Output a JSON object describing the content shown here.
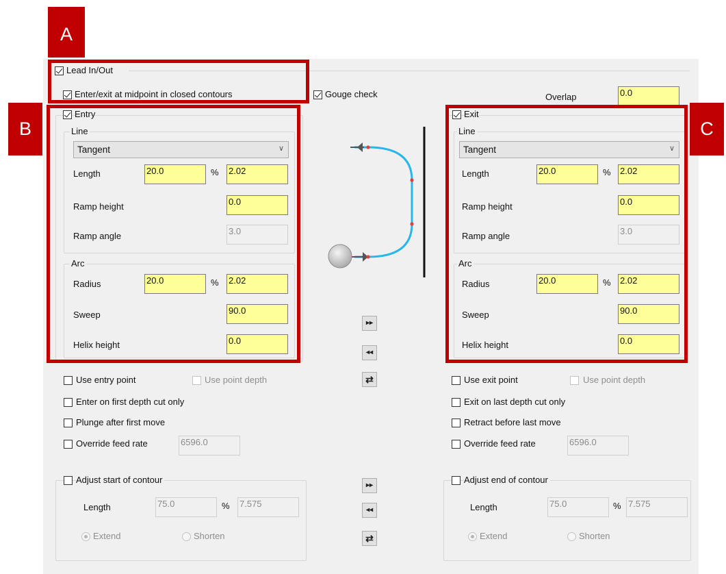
{
  "annotations": {
    "a": "A",
    "b": "B",
    "c": "C"
  },
  "lead": {
    "lead_in_out": "Lead In/Out",
    "midpoint": "Enter/exit at midpoint in closed contours",
    "gouge_check": "Gouge check",
    "overlap_label": "Overlap",
    "overlap_value": "0.0"
  },
  "entry": {
    "title": "Entry",
    "line_group": "Line",
    "line_type": "Tangent",
    "length_label": "Length",
    "length_pct": "20.0",
    "pct_symbol": "%",
    "length_abs": "2.02",
    "ramp_height_label": "Ramp height",
    "ramp_height": "0.0",
    "ramp_angle_label": "Ramp angle",
    "ramp_angle": "3.0",
    "arc_group": "Arc",
    "radius_label": "Radius",
    "radius_pct": "20.0",
    "radius_abs": "2.02",
    "sweep_label": "Sweep",
    "sweep": "90.0",
    "helix_label": "Helix height",
    "helix": "0.0",
    "use_point": "Use entry point",
    "use_point_depth": "Use point depth",
    "first_depth": "Enter on first depth cut only",
    "plunge": "Plunge after first move",
    "override_feed": "Override feed rate",
    "feed_value": "6596.0",
    "adjust": "Adjust start of contour",
    "adj_length_label": "Length",
    "adj_pct": "75.0",
    "adj_abs": "7.575",
    "extend": "Extend",
    "shorten": "Shorten"
  },
  "exit": {
    "title": "Exit",
    "line_group": "Line",
    "line_type": "Tangent",
    "length_label": "Length",
    "length_pct": "20.0",
    "pct_symbol": "%",
    "length_abs": "2.02",
    "ramp_height_label": "Ramp height",
    "ramp_height": "0.0",
    "ramp_angle_label": "Ramp angle",
    "ramp_angle": "3.0",
    "arc_group": "Arc",
    "radius_label": "Radius",
    "radius_pct": "20.0",
    "radius_abs": "2.02",
    "sweep_label": "Sweep",
    "sweep": "90.0",
    "helix_label": "Helix height",
    "helix": "0.0",
    "use_point": "Use exit point",
    "use_point_depth": "Use point depth",
    "last_depth": "Exit on last depth cut only",
    "retract": "Retract before last move",
    "override_feed": "Override feed rate",
    "feed_value": "6596.0",
    "adjust": "Adjust end of contour",
    "adj_length_label": "Length",
    "adj_pct": "75.0",
    "adj_abs": "7.575",
    "extend": "Extend",
    "shorten": "Shorten"
  },
  "buttons": {
    "forward": "▸▸",
    "back": "◂◂",
    "swap": "⇄"
  },
  "colors": {
    "field_yellow": "#ffff99",
    "annotation_red": "#c00000",
    "path_blue": "#29b6e8"
  },
  "icons": {
    "preview": "lead-path-preview-icon"
  }
}
